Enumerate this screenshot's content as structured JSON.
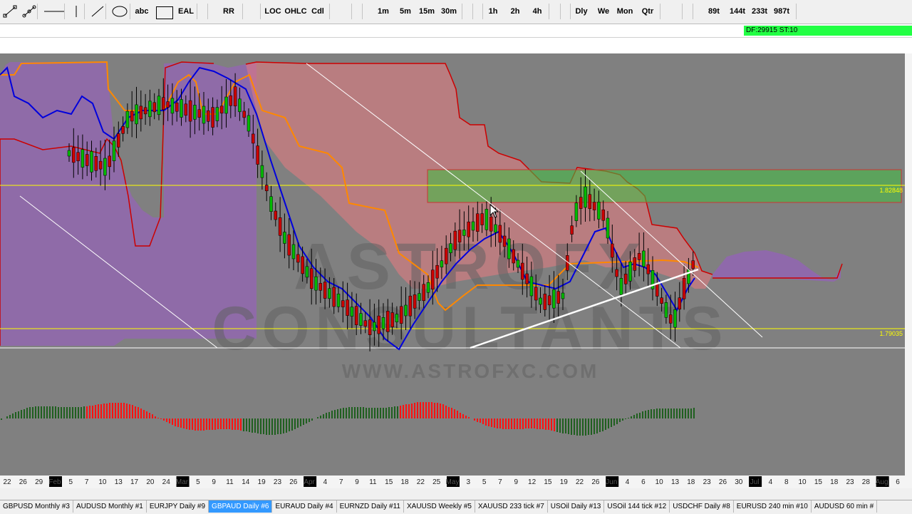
{
  "toolbar": {
    "tool_icons": [
      "trendline-icon",
      "trendline-points-icon",
      "horizontal-line-icon",
      "vertical-line-icon",
      "ray-icon",
      "ellipse-icon"
    ],
    "buttons": [
      "abc",
      "EAL",
      "RR",
      "LOC",
      "OHLC",
      "Cdl",
      "1m",
      "5m",
      "15m",
      "30m",
      "1h",
      "2h",
      "4h",
      "Dly",
      "We",
      "Mon",
      "Qtr",
      "89t",
      "144t",
      "233t",
      "987t"
    ]
  },
  "status": {
    "df_st": "DF:29915  ST:10"
  },
  "chart_data": {
    "type": "candlestick",
    "symbol": "GBPAUD Daily",
    "watermark": {
      "line1": "ASTROFX",
      "line2": "CONSULTANTS",
      "url": "WWW.ASTROFXC.COM"
    },
    "price_labels": [
      "1.82848",
      "1.79035"
    ],
    "x_tick_labels": [
      "22",
      "26",
      "29",
      "Feb",
      "5",
      "7",
      "10",
      "13",
      "17",
      "20",
      "24",
      "Mar",
      "5",
      "9",
      "11",
      "14",
      "19",
      "23",
      "26",
      "Apr",
      "4",
      "7",
      "9",
      "11",
      "15",
      "18",
      "22",
      "25",
      "May",
      "3",
      "5",
      "7",
      "9",
      "12",
      "15",
      "19",
      "22",
      "26",
      "Jun",
      "4",
      "6",
      "10",
      "13",
      "18",
      "23",
      "26",
      "30",
      "Jul",
      "4",
      "8",
      "10",
      "15",
      "18",
      "23",
      "28",
      "Aug",
      "6"
    ],
    "x_tick_highlighted": [
      "Feb",
      "Mar",
      "Apr",
      "May",
      "Jun",
      "Jul",
      "Aug"
    ],
    "colors": {
      "background": "#808080",
      "up": "#00bb00",
      "down": "#cc0000",
      "fast_ma": "#0000dd",
      "slow_ma": "#ff8800",
      "kumo_bull": "#9a5ac8",
      "kumo_bear": "#e87a80",
      "zone": "#44bb44",
      "level": "#ffff00",
      "trend": "#ffffff",
      "osc_up": "#1f5f1f",
      "osc_down": "#ff1111"
    }
  },
  "tabs": [
    {
      "label": "GBPUSD  Monthly  #3",
      "active": false
    },
    {
      "label": "AUDUSD  Monthly  #1",
      "active": false
    },
    {
      "label": "EURJPY  Daily  #9",
      "active": false
    },
    {
      "label": "GBPAUD  Daily  #6",
      "active": true
    },
    {
      "label": "EURAUD  Daily  #4",
      "active": false
    },
    {
      "label": "EURNZD  Daily  #11",
      "active": false
    },
    {
      "label": "XAUUSD  Weekly  #5",
      "active": false
    },
    {
      "label": "XAUUSD  233 tick  #7",
      "active": false
    },
    {
      "label": "USOil  Daily  #13",
      "active": false
    },
    {
      "label": "USOil  144 tick  #12",
      "active": false
    },
    {
      "label": "USDCHF  Daily  #8",
      "active": false
    },
    {
      "label": "EURUSD  240 min  #10",
      "active": false
    },
    {
      "label": "AUDUSD  60 min  #",
      "active": false
    }
  ]
}
